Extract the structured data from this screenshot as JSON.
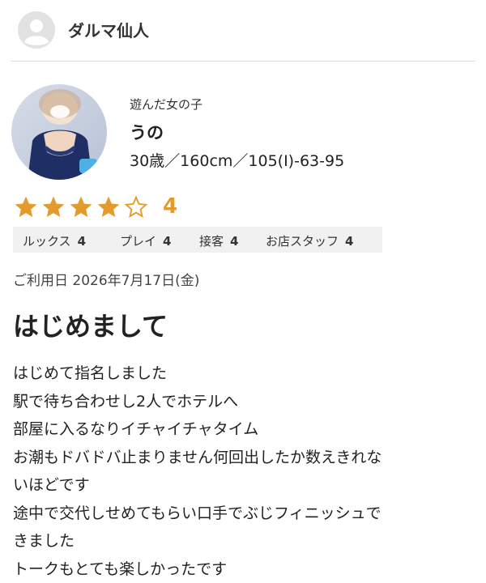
{
  "header": {
    "username": "ダルマ仙人",
    "avatar_icon": "user-avatar-icon"
  },
  "girl": {
    "caption": "遊んだ女の子",
    "name": "うの",
    "specs": "30歳／160cm／105(I)-63-95"
  },
  "rating": {
    "value": "4",
    "stars_filled": 4,
    "stars_total": 5,
    "star_color": "#e39b2d"
  },
  "scores": [
    {
      "label": "ルックス",
      "value": "4"
    },
    {
      "label": "プレイ",
      "value": "4"
    },
    {
      "label": "接客",
      "value": "4"
    },
    {
      "label": "お店スタッフ",
      "value": "4"
    }
  ],
  "review": {
    "date": "ご利用日 2026年7月17日(金)",
    "title": "はじめまして",
    "lines": [
      "はじめて指名しました",
      "駅で待ち合わせし2人でホテルへ",
      "部屋に入るなりイチャイチャタイム",
      "お潮もドバドバ止まりません何回出したか数えきれな",
      "いほどです",
      "途中で交代しせめてもらい口手でぶじフィニッシュで",
      "きました",
      "トークもとても楽しかったです"
    ]
  }
}
